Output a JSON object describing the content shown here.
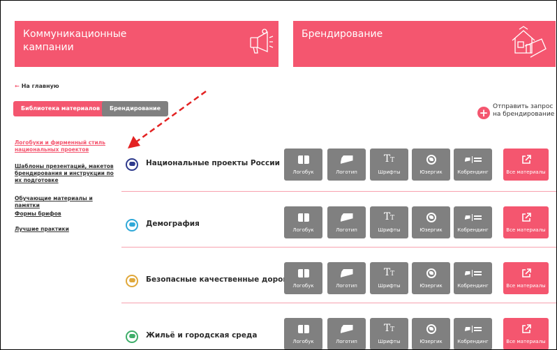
{
  "heroes": [
    {
      "title": "Коммуникационные кампании",
      "icon": "megaphone-icon"
    },
    {
      "title": "Брендирование",
      "icon": "house-brand-icon"
    }
  ],
  "back_link": "На главную",
  "tabs": [
    {
      "label": "Библиотека материалов",
      "active": true
    },
    {
      "label": "Брендирование",
      "active": false
    }
  ],
  "request": {
    "label": "Отправить запрос на брендирование",
    "icon": "plus-icon"
  },
  "sidebar": [
    {
      "label": "Логобуки и фирменный стиль национальных проектов",
      "active": true
    },
    {
      "label": "Шаблоны презентаций, макетов брендирования и инструкции по их подготовке",
      "active": false
    },
    {
      "label": "Обучающие материалы и памятки",
      "active": false
    },
    {
      "label": "Формы брифов",
      "active": false
    },
    {
      "label": "Лучшие практики",
      "active": false
    }
  ],
  "tile_labels": [
    "Логобук",
    "Логотип",
    "Шрифты",
    "Юзергик",
    "Кобрендинг",
    "Все материалы"
  ],
  "projects": [
    {
      "name": "Национальные проекты России",
      "color": "#2e3a8c"
    },
    {
      "name": "Демография",
      "color": "#2fa8d8"
    },
    {
      "name": "Безопасные качественные дороги",
      "color": "#e0a83a"
    },
    {
      "name": "Жильё и городская среда",
      "color": "#3fae6a"
    }
  ],
  "colors": {
    "accent": "#f4566f",
    "tile": "#808080",
    "annotation_arrow": "#e32222"
  }
}
